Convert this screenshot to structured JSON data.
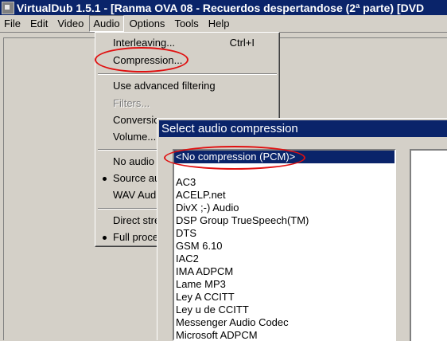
{
  "window": {
    "title": "VirtualDub 1.5.1 - [Ranma OVA 08 - Recuerdos despertandose (2ª parte) [DVD"
  },
  "menubar": {
    "items": [
      {
        "label": "File"
      },
      {
        "label": "Edit"
      },
      {
        "label": "Video"
      },
      {
        "label": "Audio"
      },
      {
        "label": "Options"
      },
      {
        "label": "Tools"
      },
      {
        "label": "Help"
      }
    ]
  },
  "audio_menu": {
    "interleaving": {
      "label": "Interleaving...",
      "shortcut": "Ctrl+I"
    },
    "compression": {
      "label": "Compression..."
    },
    "advanced_filtering": {
      "label": "Use advanced filtering"
    },
    "filters": {
      "label": "Filters..."
    },
    "conversion": {
      "label": "Conversion..."
    },
    "volume": {
      "label": "Volume..."
    },
    "no_audio": {
      "label": "No audio"
    },
    "source_audio": {
      "label": "Source audio"
    },
    "wav_audio": {
      "label": "WAV Audio..."
    },
    "direct_stream": {
      "label": "Direct stream copy"
    },
    "full_processing": {
      "label": "Full processing mode"
    }
  },
  "dialog": {
    "title": "Select audio compression",
    "codecs": [
      "<No compression (PCM)>",
      "",
      "AC3",
      "ACELP.net",
      "DivX ;-) Audio",
      "DSP Group TrueSpeech(TM)",
      "DTS",
      "GSM 6.10",
      "IAC2",
      "IMA ADPCM",
      "Lame MP3",
      "Ley A CCITT",
      "Ley u de CCITT",
      "Messenger Audio Codec",
      "Microsoft ADPCM"
    ],
    "selected_index": 0
  },
  "colors": {
    "title_bar": "#0a246a",
    "face": "#d4d0c8",
    "annotation": "#e01010"
  }
}
